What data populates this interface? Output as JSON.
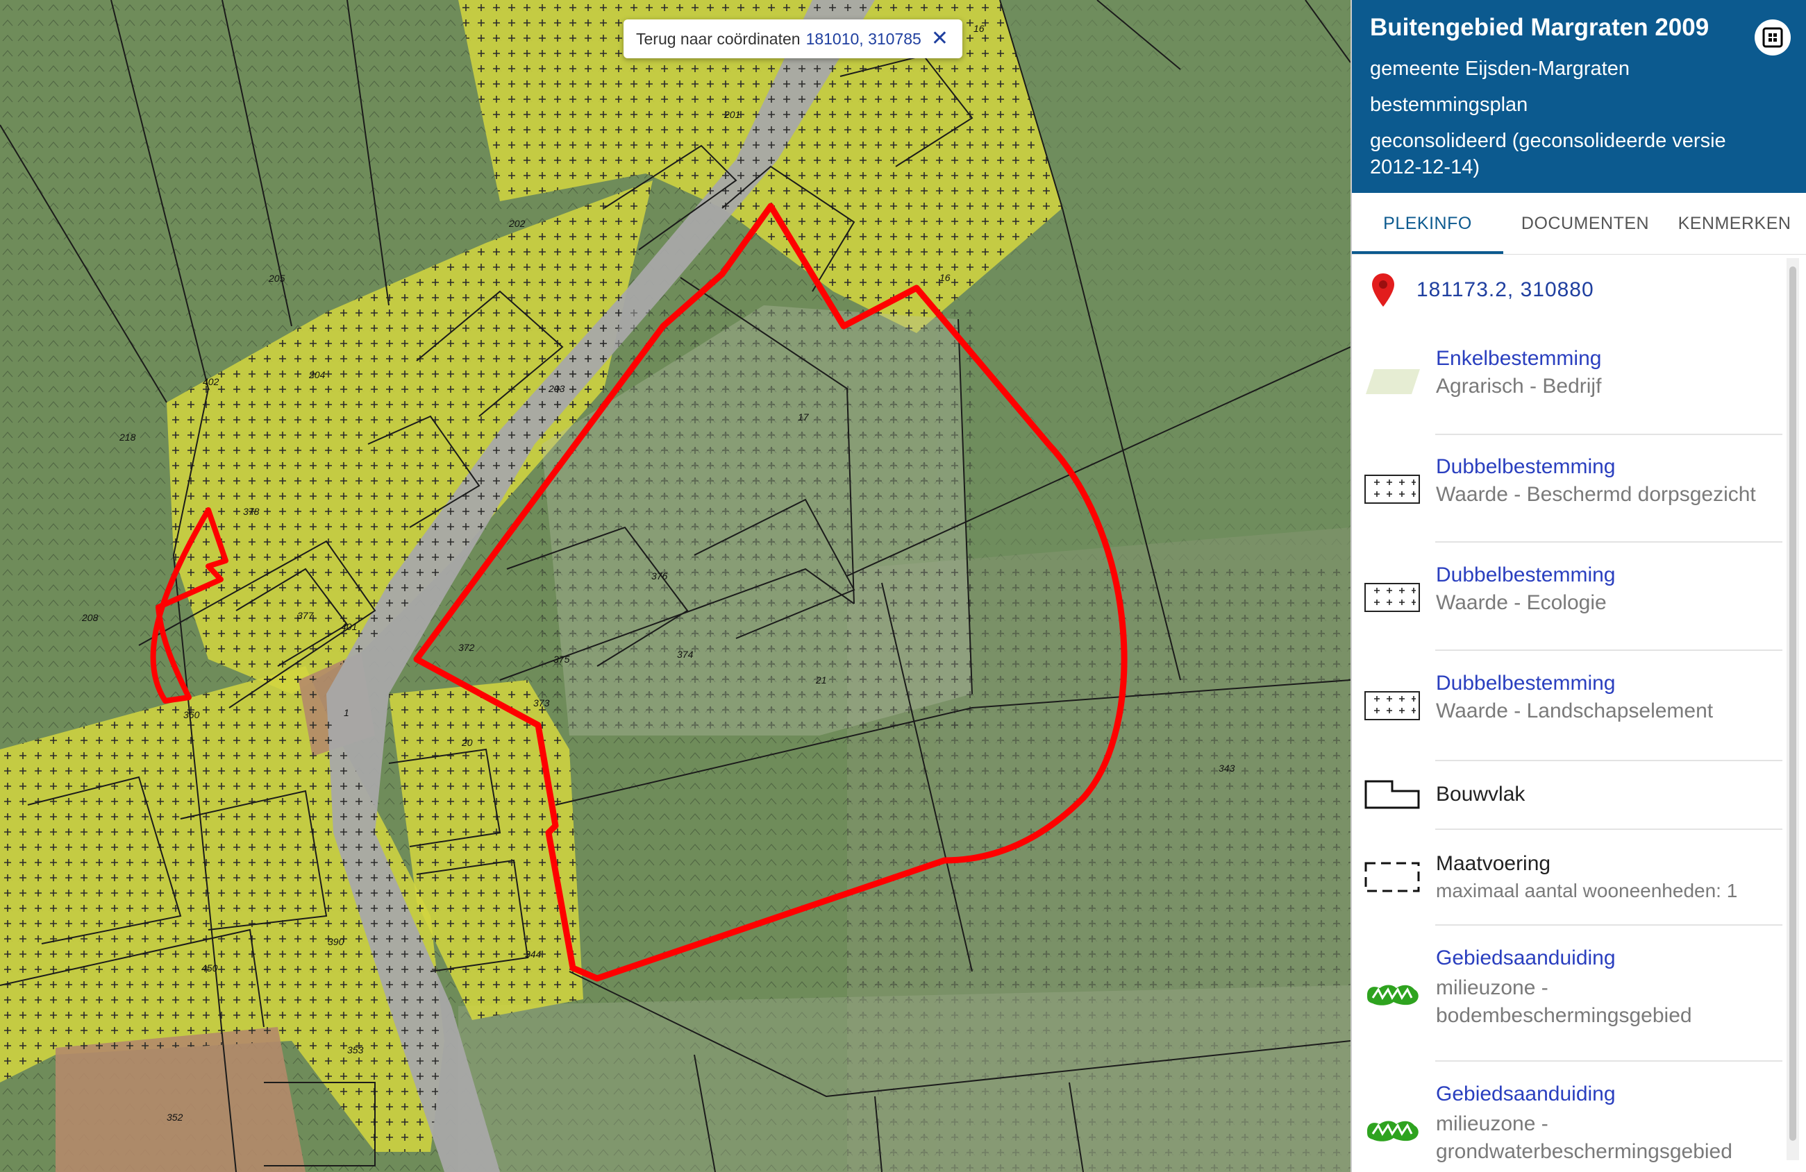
{
  "map": {
    "popup_label": "Terug naar coördinaten",
    "popup_coords": "181010, 310785",
    "parcel_labels": [
      {
        "text": "16"
      },
      {
        "text": "201"
      },
      {
        "text": "202"
      },
      {
        "text": "205"
      },
      {
        "text": "204"
      },
      {
        "text": "203"
      },
      {
        "text": "402"
      },
      {
        "text": "218"
      },
      {
        "text": "378"
      },
      {
        "text": "377"
      },
      {
        "text": "401"
      },
      {
        "text": "208"
      },
      {
        "text": "17"
      },
      {
        "text": "376"
      },
      {
        "text": "372"
      },
      {
        "text": "375"
      },
      {
        "text": "374"
      },
      {
        "text": "373"
      },
      {
        "text": "21"
      },
      {
        "text": "360"
      },
      {
        "text": "20"
      },
      {
        "text": "1"
      },
      {
        "text": "343"
      },
      {
        "text": "390"
      },
      {
        "text": "450"
      },
      {
        "text": "344"
      },
      {
        "text": "353"
      },
      {
        "text": "352"
      },
      {
        "text": "16"
      }
    ],
    "colors": {
      "agrarisch": "#6b8a55",
      "wonen": "#d6d83e",
      "verkeer": "#a8a8a8",
      "gemengd": "#b48a6a",
      "highlight": "#ff0000"
    }
  },
  "panel": {
    "title": "Buitengebied Margraten 2009",
    "municipality": "gemeente Eijsden-Margraten",
    "plan_type": "bestemmingsplan",
    "status": "geconsolideerd (geconsolideerde versie 2012-12-14)",
    "tabs": [
      {
        "label": "PLEKINFO",
        "active": true
      },
      {
        "label": "DOCUMENTEN",
        "active": false
      },
      {
        "label": "KENMERKEN",
        "active": false
      }
    ],
    "location": "181173.2, 310880",
    "items": [
      {
        "title": "Enkelbestemming",
        "subtitle": "Agrarisch - Bedrijf",
        "icon": "agrarisch-swatch-icon",
        "link": true
      },
      {
        "title": "Dubbelbestemming",
        "subtitle": "Waarde - Beschermd dorpsgezicht",
        "icon": "grid-hatch-icon",
        "link": true
      },
      {
        "title": "Dubbelbestemming",
        "subtitle": "Waarde - Ecologie",
        "icon": "grid-hatch-icon",
        "link": true
      },
      {
        "title": "Dubbelbestemming",
        "subtitle": "Waarde - Landschapselement",
        "icon": "grid-hatch-icon",
        "link": true
      },
      {
        "title": "Bouwvlak",
        "subtitle": "",
        "icon": "bouwvlak-outline-icon",
        "link": false
      },
      {
        "title": "Maatvoering",
        "subtitle": "maximaal aantal wooneenheden: 1",
        "icon": "dashed-box-icon",
        "link": false
      },
      {
        "title": "Gebiedsaanduiding",
        "subtitle": "milieuzone - bodembeschermingsgebied",
        "icon": "green-zone-icon",
        "link": true
      },
      {
        "title": "Gebiedsaanduiding",
        "subtitle": "milieuzone - grondwaterbeschermingsgebied",
        "icon": "green-zone-icon",
        "link": true
      }
    ]
  }
}
